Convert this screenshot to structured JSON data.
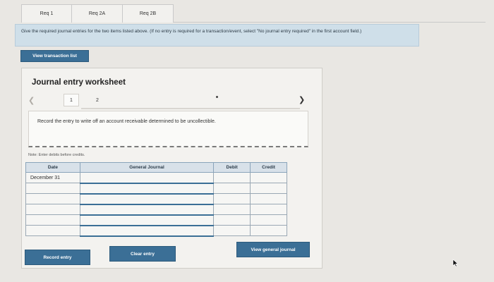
{
  "tabs": [
    {
      "label": "Req 1"
    },
    {
      "label": "Req 2A"
    },
    {
      "label": "Req 2B"
    }
  ],
  "instructions": "Give the required journal entries for the two items listed above. (If no entry is required for a transaction/event, select \"No journal entry required\" in the first account field.)",
  "view_transaction_list_label": "View transaction list",
  "worksheet": {
    "title": "Journal entry worksheet",
    "pages": [
      "1",
      "2"
    ],
    "record_description": "Record the entry to write off an account receivable determined to be uncollectible.",
    "note": "Note: Enter debits before credits.",
    "columns": [
      "Date",
      "General Journal",
      "Debit",
      "Credit"
    ],
    "rows": [
      {
        "date": "December 31"
      },
      {
        "date": ""
      },
      {
        "date": ""
      },
      {
        "date": ""
      },
      {
        "date": ""
      },
      {
        "date": ""
      }
    ],
    "record_entry_label": "Record entry",
    "clear_entry_label": "Clear entry",
    "view_general_journal_label": "View general journal"
  },
  "colors": {
    "primary_button": "#3b6f96",
    "instruction_bg": "#cfdfe9",
    "table_header_bg": "#d8e1e9"
  },
  "icons": {
    "prev": "chevron-left-icon",
    "next": "chevron-right-icon",
    "cursor": "mouse-cursor-icon"
  }
}
